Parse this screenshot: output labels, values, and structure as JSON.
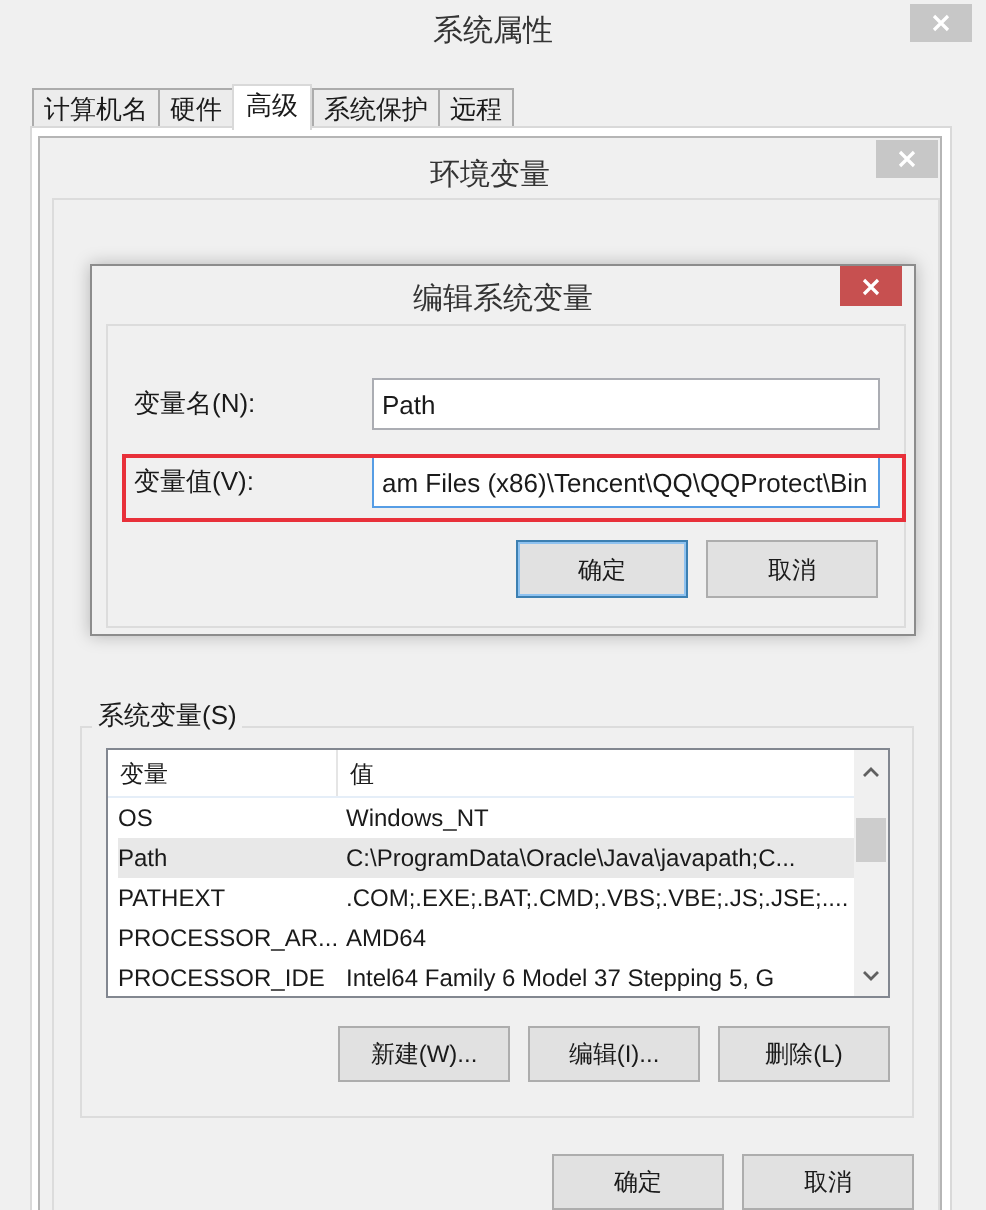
{
  "system_properties": {
    "title": "系统属性",
    "tabs": [
      {
        "label": "计算机名",
        "selected": false
      },
      {
        "label": "硬件",
        "selected": false
      },
      {
        "label": "高级",
        "selected": true
      },
      {
        "label": "系统保护",
        "selected": false
      },
      {
        "label": "远程",
        "selected": false
      }
    ]
  },
  "environment_variables": {
    "title": "环境变量",
    "system_variables": {
      "label": "系统变量(S)",
      "columns": [
        "变量",
        "值"
      ],
      "rows": [
        {
          "name": "OS",
          "value": "Windows_NT",
          "selected": false
        },
        {
          "name": "Path",
          "value": "C:\\ProgramData\\Oracle\\Java\\javapath;C...",
          "selected": true
        },
        {
          "name": "PATHEXT",
          "value": ".COM;.EXE;.BAT;.CMD;.VBS;.VBE;.JS;.JSE;....",
          "selected": false
        },
        {
          "name": "PROCESSOR_AR...",
          "value": "AMD64",
          "selected": false
        },
        {
          "name": "PROCESSOR_IDE",
          "value": "Intel64 Family 6 Model 37 Stepping 5, G",
          "selected": false
        }
      ],
      "buttons": [
        "新建(W)...",
        "编辑(I)...",
        "删除(L)"
      ]
    },
    "buttons": [
      "确定",
      "取消"
    ]
  },
  "edit_dialog": {
    "title": "编辑系统变量",
    "fields": [
      {
        "label": "变量名(N):",
        "value": "Path",
        "focused": false
      },
      {
        "label": "变量值(V):",
        "value": "am Files (x86)\\Tencent\\QQ\\QQProtect\\Bin",
        "focused": true
      }
    ],
    "buttons": [
      {
        "label": "确定",
        "default": true
      },
      {
        "label": "取消",
        "default": false
      }
    ]
  }
}
